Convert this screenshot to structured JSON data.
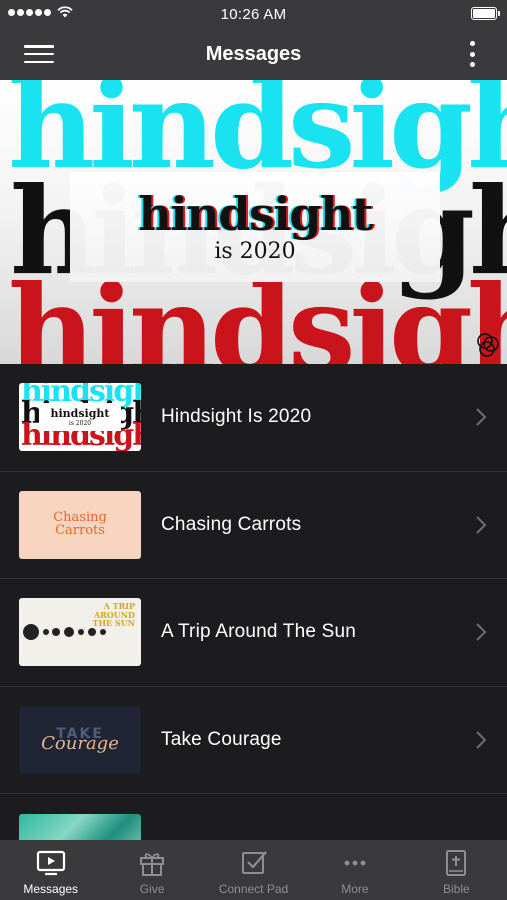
{
  "status": {
    "time": "10:26 AM"
  },
  "header": {
    "title": "Messages"
  },
  "hero": {
    "repeat_word": "hindsight",
    "title": "hindsight",
    "subtitle": "is 2020"
  },
  "messages": [
    {
      "title": "Hindsight Is 2020",
      "thumb_word": "hindsight",
      "thumb_title": "hindsight",
      "thumb_sub": "is 2020"
    },
    {
      "title": "Chasing Carrots",
      "thumb_line1": "Chasing",
      "thumb_line2": "Carrots"
    },
    {
      "title": "A Trip Around The Sun",
      "thumb_line1": "A TRIP",
      "thumb_line2": "AROUND",
      "thumb_line3": "THE SUN"
    },
    {
      "title": "Take Courage",
      "thumb_line1": "TAKE",
      "thumb_line2": "Courage"
    },
    {
      "title": ""
    }
  ],
  "tabs": [
    {
      "label": "Messages",
      "icon": "tv-icon",
      "active": true
    },
    {
      "label": "Give",
      "icon": "gift-icon",
      "active": false
    },
    {
      "label": "Connect Pad",
      "icon": "checkbox-icon",
      "active": false
    },
    {
      "label": "More",
      "icon": "ellipsis-icon",
      "active": false
    },
    {
      "label": "Bible",
      "icon": "bible-icon",
      "active": false
    }
  ],
  "colors": {
    "bar_background": "#3a3a3c",
    "list_background": "#1c1c1e",
    "accent_cyan": "#19e3f0",
    "accent_red": "#c8141a",
    "inactive_tab": "#8e8e93"
  }
}
